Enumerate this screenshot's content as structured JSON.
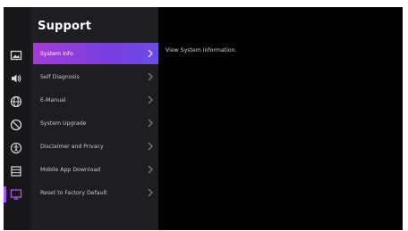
{
  "menu": {
    "title": "Support",
    "items": [
      {
        "label": "System Info",
        "selected": true
      },
      {
        "label": "Self Diagnosis",
        "selected": false
      },
      {
        "label": "E-Manual",
        "selected": false
      },
      {
        "label": "System Upgrade",
        "selected": false
      },
      {
        "label": "Disclaimer and Privacy",
        "selected": false
      },
      {
        "label": "Mobile App Download",
        "selected": false
      },
      {
        "label": "Reset to Factory Default",
        "selected": false
      }
    ]
  },
  "description": "View System Information.",
  "rail": {
    "icons": [
      "picture-icon",
      "sound-icon",
      "network-icon",
      "restriction-icon",
      "accessibility-icon",
      "list-icon",
      "support-icon"
    ],
    "active_icon": "support-icon"
  },
  "colors": {
    "accent": "#a855f7",
    "selected_gradient_start": "#a43bd6",
    "selected_gradient_end": "#6b4ae6",
    "menu_bg": "#1e1e22",
    "background": "#000000"
  }
}
